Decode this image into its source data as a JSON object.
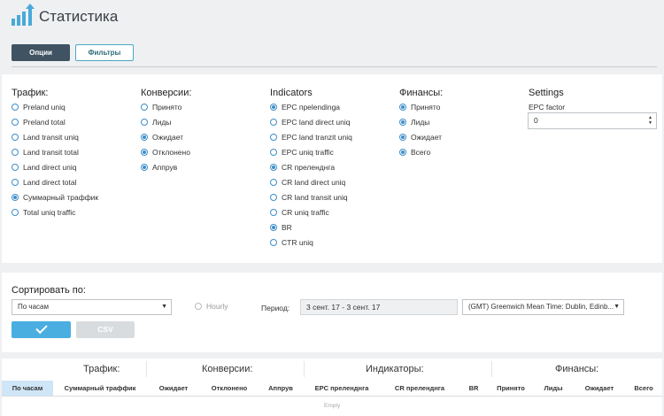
{
  "header": {
    "title": "Статистика",
    "logo_icon": "bar-chart-up-arrow-icon"
  },
  "tabs": {
    "options": "Опции",
    "filters": "Фильтры"
  },
  "groups": {
    "traffic": {
      "title": "Трафик:",
      "items": [
        {
          "label": "Preland uniq",
          "checked": false
        },
        {
          "label": "Preland total",
          "checked": false
        },
        {
          "label": "Land transit uniq",
          "checked": false
        },
        {
          "label": "Land transit total",
          "checked": false
        },
        {
          "label": "Land direct uniq",
          "checked": false
        },
        {
          "label": "Land direct total",
          "checked": false
        },
        {
          "label": "Суммарный траффик",
          "checked": true
        },
        {
          "label": "Total uniq traffic",
          "checked": false
        }
      ]
    },
    "conversions": {
      "title": "Конверсии:",
      "items": [
        {
          "label": "Принято",
          "checked": false
        },
        {
          "label": "Лиды",
          "checked": false
        },
        {
          "label": "Ожидает",
          "checked": true
        },
        {
          "label": "Отклонено",
          "checked": true
        },
        {
          "label": "Аппрув",
          "checked": true
        }
      ]
    },
    "indicators": {
      "title": "Indicators",
      "items": [
        {
          "label": "EPC преlendinga",
          "checked": true
        },
        {
          "label": "EPC land direct uniq",
          "checked": false
        },
        {
          "label": "EPC land tranzit uniq",
          "checked": false
        },
        {
          "label": "EPC uniq traffic",
          "checked": false
        },
        {
          "label": "CR преленднга",
          "checked": true
        },
        {
          "label": "CR land direct uniq",
          "checked": false
        },
        {
          "label": "CR land transit uniq",
          "checked": false
        },
        {
          "label": "CR uniq traffic",
          "checked": false
        },
        {
          "label": "BR",
          "checked": true
        },
        {
          "label": "CTR uniq",
          "checked": false
        }
      ]
    },
    "finances": {
      "title": "Финансы:",
      "items": [
        {
          "label": "Принято",
          "checked": true
        },
        {
          "label": "Лиды",
          "checked": true
        },
        {
          "label": "Ожидает",
          "checked": true
        },
        {
          "label": "Всего",
          "checked": true
        }
      ]
    }
  },
  "settings": {
    "title": "Settings",
    "epc_label": "EPC factor",
    "epc_value": "0"
  },
  "sort": {
    "label": "Сортировать по:",
    "value": "По часам",
    "hourly": "Hourly",
    "period_label": "Период:",
    "period_value": "3 сент. 17 - 3 сент. 17",
    "timezone": "(GMT) Greenwich Mean Time: Dublin, Edinb..."
  },
  "actions": {
    "csv": "CSV"
  },
  "table": {
    "groups": [
      "Трафик:",
      "Конверсии:",
      "Индикаторы:",
      "Финансы:"
    ],
    "columns": [
      "По часам",
      "Суммарный траффик",
      "Ожидает",
      "Отклонено",
      "Аппрув",
      "EPC преленднга",
      "CR преленднга",
      "BR",
      "Принято",
      "Лиды",
      "Ожидает",
      "Всего"
    ],
    "empty": "Empty"
  },
  "colors": {
    "accent": "#4aaee0",
    "dark_button": "#3f5362",
    "radio": "#3d8ec9"
  }
}
